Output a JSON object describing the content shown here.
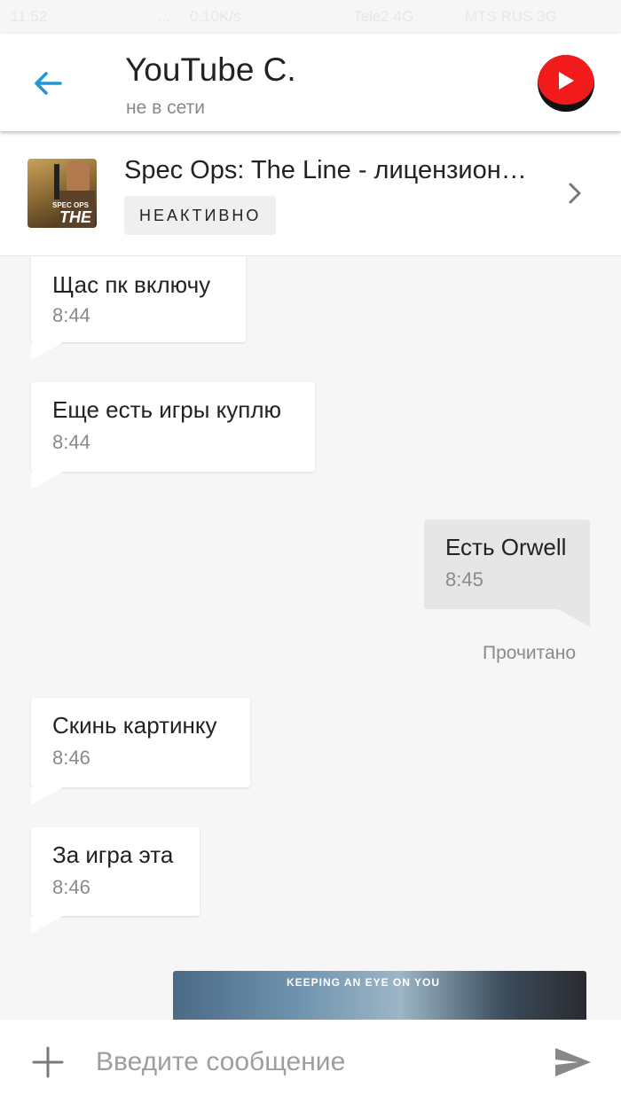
{
  "statusbar": {
    "time": "11:52",
    "dots": "...",
    "speed": "0.10K/s",
    "carrier1": "Tele2 4G",
    "carrier2": "MTS RUS 3G"
  },
  "header": {
    "contact_name": "YouTube C.",
    "contact_status": "не в сети",
    "back_icon": "arrow-left-icon",
    "avatar_icon": "youtube-play-icon",
    "accent_color": "#2196d3"
  },
  "product": {
    "title": "Spec Ops: The Line - лицензион…",
    "badge": "НЕАКТИВНО",
    "thumb_text_top": "SPEC OPS",
    "thumb_text_main": "THE L"
  },
  "messages": [
    {
      "direction": "in",
      "text": "Щас пк включу",
      "time": "8:44"
    },
    {
      "direction": "in",
      "text": "Еще есть игры куплю",
      "time": "8:44"
    },
    {
      "direction": "out",
      "text": "Есть Orwell",
      "time": "8:45"
    },
    {
      "direction": "in",
      "text": "Скинь картинку",
      "time": "8:46"
    },
    {
      "direction": "in",
      "text": "За игра эта",
      "time": "8:46"
    }
  ],
  "read_receipt": "Прочитано",
  "image_message": {
    "caption": "KEEPING AN EYE ON YOU"
  },
  "composer": {
    "placeholder": "Введите сообщение",
    "plus_icon": "plus-icon",
    "send_icon": "send-icon"
  }
}
